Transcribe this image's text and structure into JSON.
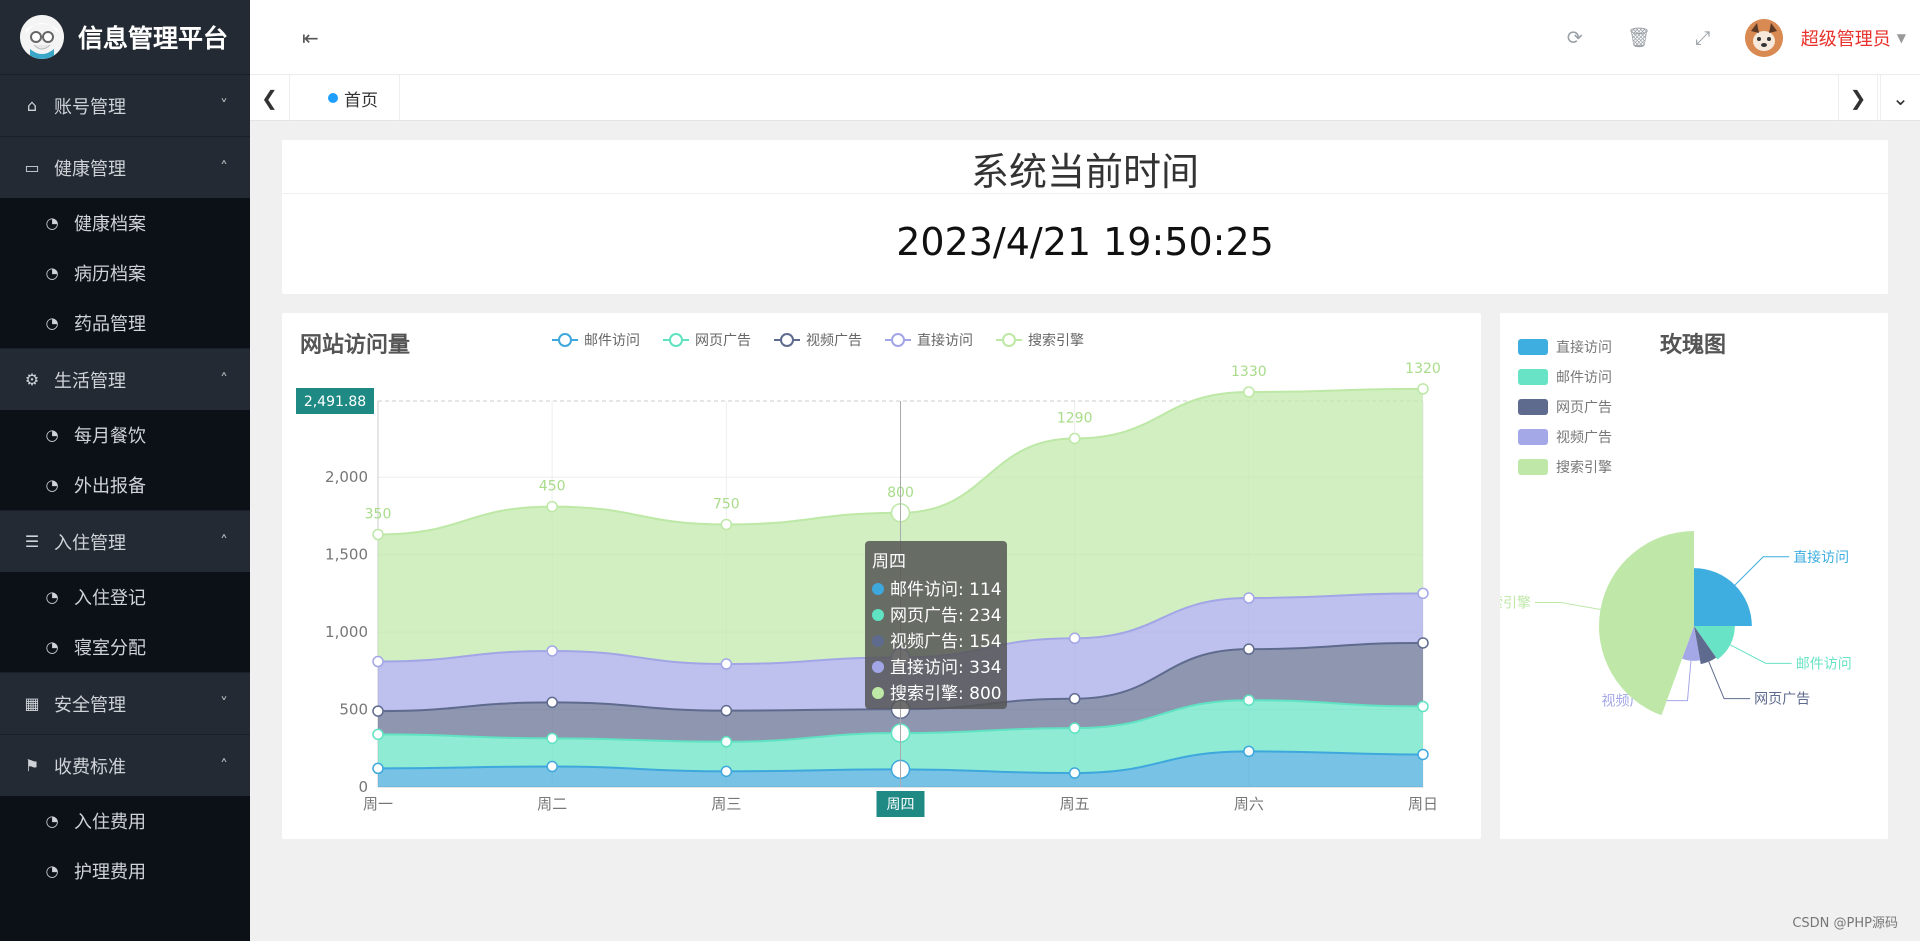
{
  "app": {
    "title": "信息管理平台"
  },
  "sidebar": {
    "groups": [
      {
        "label": "账号管理",
        "icon": "home-icon",
        "expanded": false,
        "items": []
      },
      {
        "label": "健康管理",
        "icon": "window-icon",
        "expanded": true,
        "items": [
          {
            "label": "健康档案"
          },
          {
            "label": "病历档案"
          },
          {
            "label": "药品管理"
          }
        ]
      },
      {
        "label": "生活管理",
        "icon": "gears-icon",
        "expanded": true,
        "items": [
          {
            "label": "每月餐饮"
          },
          {
            "label": "外出报备"
          }
        ]
      },
      {
        "label": "入住管理",
        "icon": "document-icon",
        "expanded": true,
        "items": [
          {
            "label": "入住登记"
          },
          {
            "label": "寝室分配"
          }
        ]
      },
      {
        "label": "安全管理",
        "icon": "calendar-icon",
        "expanded": false,
        "items": []
      },
      {
        "label": "收费标准",
        "icon": "flag-icon",
        "expanded": true,
        "items": [
          {
            "label": "入住费用"
          },
          {
            "label": "护理费用"
          }
        ]
      }
    ]
  },
  "topbar": {
    "user_name": "超级管理员"
  },
  "tabs": {
    "home_label": "首页"
  },
  "time_card": {
    "title": "系统当前时间",
    "value": "2023/4/21 19:50:25"
  },
  "line_chart_title": "网站访问量",
  "rose_chart_title": "玫瑰图",
  "watermark": "CSDN @PHP源码",
  "chart_data": [
    {
      "type": "area",
      "title": "网站访问量",
      "categories": [
        "周一",
        "周二",
        "周三",
        "周四",
        "周五",
        "周六",
        "周日"
      ],
      "stacked": true,
      "ylim": [
        0,
        2491.88
      ],
      "yticks": [
        0,
        500,
        1000,
        1500,
        2000
      ],
      "legend_position": "top-center",
      "series": [
        {
          "name": "邮件访问",
          "color": "#3ea8dc",
          "values": [
            120,
            132,
            101,
            114,
            90,
            230,
            210
          ]
        },
        {
          "name": "网页广告",
          "color": "#5fe3c2",
          "values": [
            220,
            182,
            191,
            234,
            290,
            330,
            310
          ]
        },
        {
          "name": "视频广告",
          "color": "#5f6b8e",
          "values": [
            150,
            232,
            201,
            154,
            190,
            330,
            410
          ]
        },
        {
          "name": "直接访问",
          "color": "#a2a6e6",
          "values": [
            320,
            332,
            301,
            334,
            390,
            330,
            320
          ]
        },
        {
          "name": "搜索引擎",
          "color": "#bde8a6",
          "values": [
            820,
            932,
            901,
            934,
            1290,
            1330,
            1320
          ]
        }
      ],
      "data_labels": [
        "350",
        "450",
        "750",
        "800",
        "1290",
        "1330",
        "1320"
      ],
      "axis_pointer": {
        "y_label": "2,491.88",
        "x_label": "周四"
      },
      "tooltip": {
        "title": "周四",
        "rows": [
          "邮件访问: 114",
          "网页广告: 234",
          "视频广告: 154",
          "直接访问: 334",
          "搜索引擎: 800"
        ]
      }
    },
    {
      "type": "pie",
      "subtype": "rose",
      "title": "玫瑰图",
      "legend_position": "top-left",
      "slices": [
        {
          "name": "直接访问",
          "color": "#3eaee0",
          "value": 335
        },
        {
          "name": "邮件访问",
          "color": "#69e3c5",
          "value": 110
        },
        {
          "name": "网页广告",
          "color": "#5f6b8e",
          "value": 90
        },
        {
          "name": "视频广告",
          "color": "#a4a8e6",
          "value": 60
        },
        {
          "name": "搜索引擎",
          "color": "#bfe8a8",
          "value": 1250
        }
      ],
      "slice_labels": [
        "直接访问",
        "邮件访问",
        "网页广告",
        "视频广告",
        "搜索引擎"
      ]
    }
  ]
}
